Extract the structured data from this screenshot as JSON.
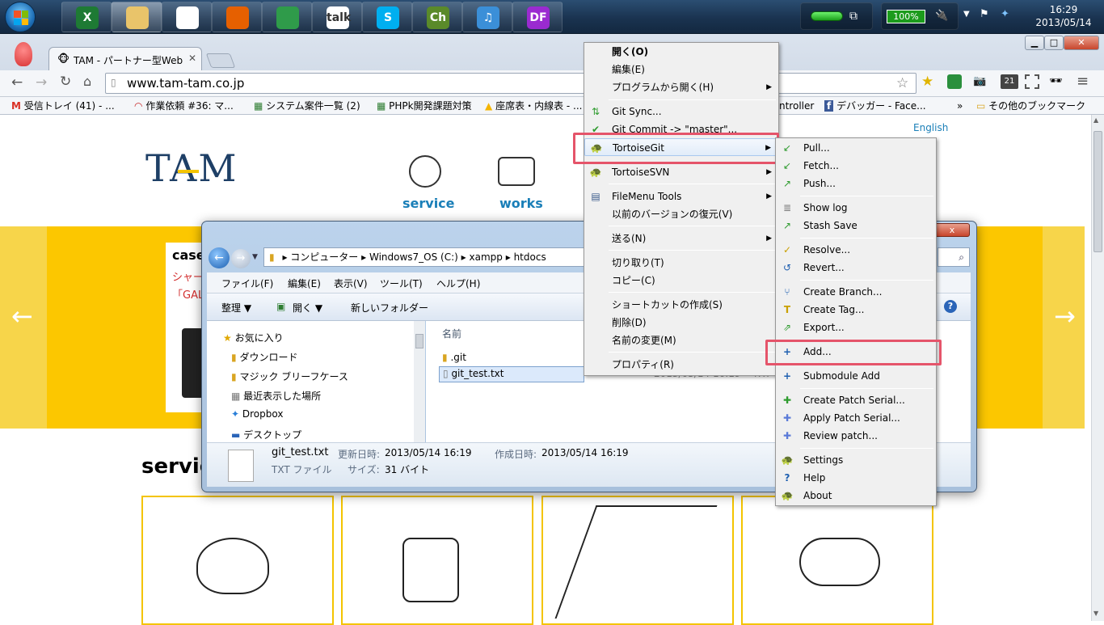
{
  "taskbar": {
    "apps": [
      {
        "icon": "excel-icon",
        "glyph": "X",
        "color": "#1e7a34"
      },
      {
        "icon": "explorer-icon",
        "glyph": "",
        "color": "#e9c46a"
      },
      {
        "icon": "app-grid-icon",
        "glyph": "",
        "color": "#ffffff"
      },
      {
        "icon": "firefox-icon",
        "glyph": "",
        "color": "#e66000"
      },
      {
        "icon": "chrome-icon",
        "glyph": "",
        "color": "#2f9b4a"
      },
      {
        "icon": "gtalk-icon",
        "glyph": "talk",
        "color": "#ffffff"
      },
      {
        "icon": "skype-icon",
        "glyph": "S",
        "color": "#00aff0"
      },
      {
        "icon": "chrome-app-icon",
        "glyph": "Ch",
        "color": "#5a8a2a"
      },
      {
        "icon": "itunes-icon",
        "glyph": "♫",
        "color": "#3b8fd8"
      },
      {
        "icon": "df-icon",
        "glyph": "DF",
        "color": "#9a2bd0"
      }
    ],
    "battery": "100%",
    "clock_time": "16:29",
    "clock_date": "2013/05/14"
  },
  "browser": {
    "tab_title": "TAM - パートナー型Web",
    "url": "www.tam-tam.co.jp",
    "bookmarks": [
      "受信トレイ (41) - ...",
      "作業依頼 #36: マ...",
      "システム案件一覧 (2)",
      "PHPk開発課題対策",
      "座席表・内線表 - ...",
      "ntroller",
      "デバッガー - Face...",
      "»",
      "その他のブックマーク"
    ]
  },
  "site": {
    "english_link": "English",
    "logo": "TAM",
    "nav": [
      "service",
      "works"
    ],
    "slider_case": "case",
    "slider_red1": "シャー",
    "slider_red2": "「GAL",
    "section_title": "servic"
  },
  "explorer": {
    "breadcrumb": [
      "コンピューター",
      "Windows7_OS (C:)",
      "xampp",
      "htdocs"
    ],
    "menu": [
      "ファイル(F)",
      "編集(E)",
      "表示(V)",
      "ツール(T)",
      "ヘルプ(H)"
    ],
    "cmd": {
      "organize": "整理 ▼",
      "open": "開く ▼",
      "new_folder": "新しいフォルダー"
    },
    "nav_items": [
      "お気に入り",
      "ダウンロード",
      "マジック ブリーフケース",
      "最近表示した場所",
      "Dropbox",
      "デスクトップ"
    ],
    "column_name": "名前",
    "files": [
      ".git",
      "git_test.txt"
    ],
    "file_date_partial": "2013/05/14 16:19",
    "file_type_partial": "TXT",
    "details": {
      "name": "git_test.txt",
      "modified_label": "更新日時:",
      "modified": "2013/05/14 16:19",
      "created_label": "作成日時:",
      "created": "2013/05/14 16:19",
      "type": "TXT ファイル",
      "size_label": "サイズ:",
      "size": "31 バイト"
    },
    "close": "x"
  },
  "context_menu": {
    "items": [
      "開く(O)",
      "編集(E)",
      "プログラムから開く(H)",
      "Git Sync...",
      "Git Commit -> \"master\"...",
      "TortoiseGit",
      "TortoiseSVN",
      "FileMenu Tools",
      "以前のバージョンの復元(V)",
      "送る(N)",
      "切り取り(T)",
      "コピー(C)",
      "ショートカットの作成(S)",
      "削除(D)",
      "名前の変更(M)",
      "プロパティ(R)"
    ]
  },
  "submenu": {
    "items": [
      "Pull...",
      "Fetch...",
      "Push...",
      "Show log",
      "Stash Save",
      "Resolve...",
      "Revert...",
      "Create Branch...",
      "Create Tag...",
      "Export...",
      "Add...",
      "Submodule Add",
      "Create Patch Serial...",
      "Apply Patch Serial...",
      "Review patch...",
      "Settings",
      "Help",
      "About"
    ]
  }
}
